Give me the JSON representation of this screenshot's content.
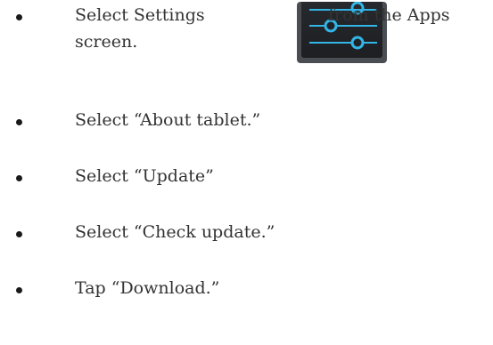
{
  "steps": [
    {
      "text_before_icon": "Select Settings",
      "icon": "settings-icon",
      "text_after_icon": "from the Apps",
      "text_continued": "screen."
    },
    {
      "text": "Select “About tablet.”"
    },
    {
      "text": "Select “Update”"
    },
    {
      "text": "Select “Check update.”"
    },
    {
      "text": "Tap “Download.”"
    }
  ],
  "colors": {
    "text": "#333333",
    "bullet": "#1a1a1a",
    "icon_frame": "#4a4e52",
    "icon_bg": "#1d1f22",
    "icon_slider": "#33b5e5"
  }
}
